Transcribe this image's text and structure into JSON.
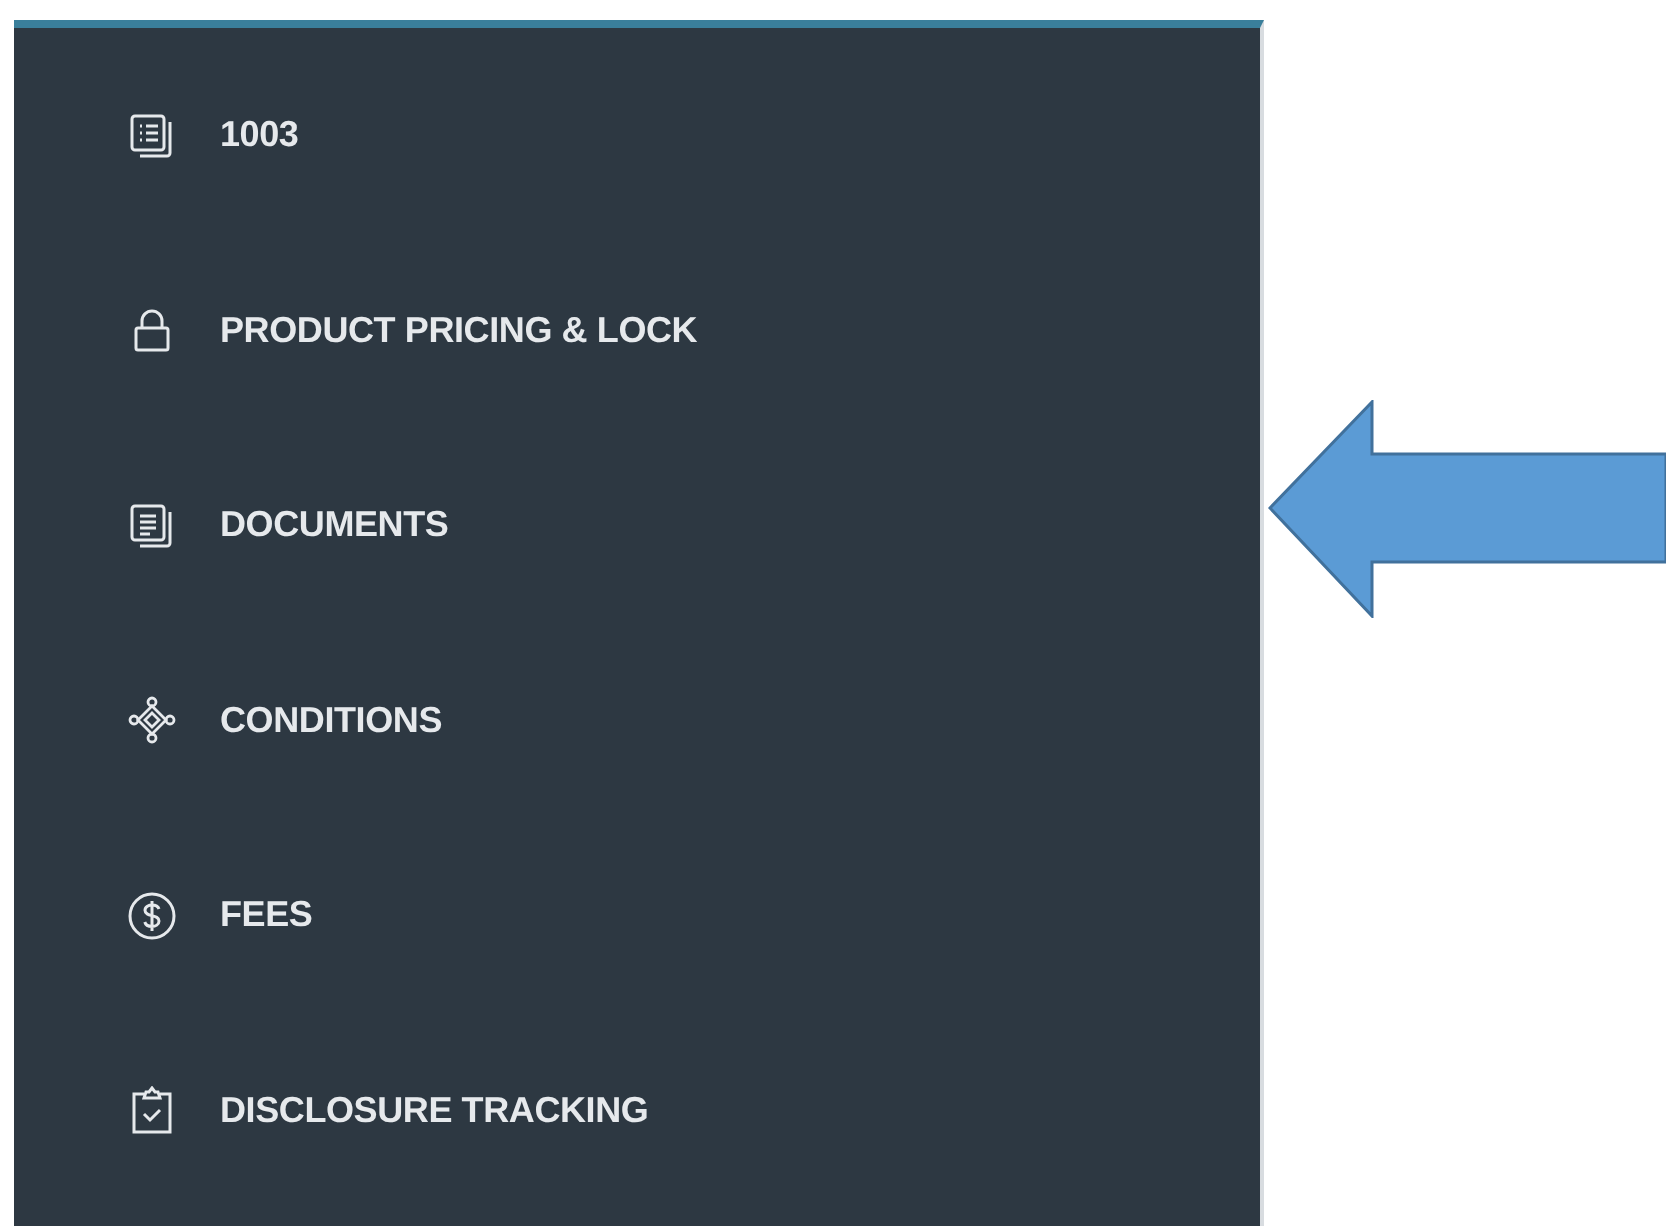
{
  "sidebar": {
    "items": [
      {
        "label": "1003",
        "kind": "form"
      },
      {
        "label": "PRODUCT PRICING & LOCK",
        "kind": "lock"
      },
      {
        "label": "DOCUMENTS",
        "kind": "documents"
      },
      {
        "label": "CONDITIONS",
        "kind": "conditions"
      },
      {
        "label": "FEES",
        "kind": "fees"
      },
      {
        "label": "DISCLOSURE TRACKING",
        "kind": "disclosure"
      }
    ]
  }
}
